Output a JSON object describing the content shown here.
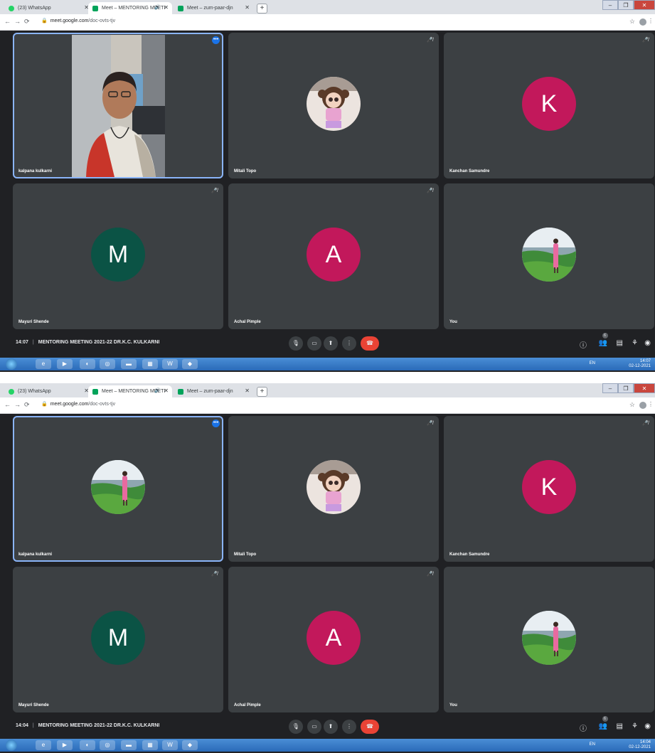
{
  "screenshots": [
    {
      "tabs": [
        {
          "label": "(23) WhatsApp",
          "active": false
        },
        {
          "label": "Meet – MENTORING MEETI",
          "active": true
        },
        {
          "label": "Meet – zum-paar-djn",
          "active": false
        }
      ],
      "url": {
        "host": "meet.google.com",
        "path": "/doc-ovts-tjv"
      },
      "tiles": [
        {
          "name": "kalpana kulkarni",
          "type": "video",
          "speaking": true
        },
        {
          "name": "Mitali Topo",
          "type": "doll",
          "muted": true
        },
        {
          "name": "Kanchan Samundre",
          "type": "letter",
          "letter": "K",
          "color": "#c2185b",
          "muted": true
        },
        {
          "name": "Mayuri Shende",
          "type": "letter",
          "letter": "M",
          "color": "#0b5345",
          "muted": true
        },
        {
          "name": "Achal Pimple",
          "type": "letter",
          "letter": "A",
          "color": "#c2185b",
          "muted": true
        },
        {
          "name": "You",
          "type": "landscape",
          "muted": false
        }
      ],
      "time": "14:07",
      "meeting_title": "MENTORING MEETING 2021-22 DR.K.C. KULKARNI",
      "participants_badge": "6",
      "tray": {
        "lang": "EN",
        "time": "14:07",
        "date": "02-12-2021"
      }
    },
    {
      "tabs": [
        {
          "label": "(23) WhatsApp",
          "active": false
        },
        {
          "label": "Meet – MENTORING MEETI",
          "active": true
        },
        {
          "label": "Meet – zum-paar-djn",
          "active": false
        }
      ],
      "url": {
        "host": "meet.google.com",
        "path": "/doc-ovts-tjv"
      },
      "tiles": [
        {
          "name": "kalpana kulkarni",
          "type": "landscape",
          "speaking": true
        },
        {
          "name": "Mitali Topo",
          "type": "doll",
          "muted": true
        },
        {
          "name": "Kanchan Samundre",
          "type": "letter",
          "letter": "K",
          "color": "#c2185b",
          "muted": true
        },
        {
          "name": "Mayuri Shende",
          "type": "letter",
          "letter": "M",
          "color": "#0b5345",
          "muted": true
        },
        {
          "name": "Achal Pimple",
          "type": "letter",
          "letter": "A",
          "color": "#c2185b",
          "muted": true
        },
        {
          "name": "You",
          "type": "landscape",
          "muted": false
        }
      ],
      "time": "14:04",
      "meeting_title": "MENTORING MEETING 2021-22 DR.K.C. KULKARNI",
      "participants_badge": "6",
      "tray": {
        "lang": "EN",
        "time": "14:04",
        "date": "02-12-2021"
      }
    }
  ]
}
